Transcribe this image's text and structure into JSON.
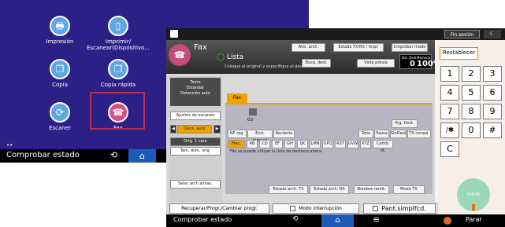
{
  "background": {
    "apps": [
      "Impresión",
      "Imprimir/ Escanear(Dispositivo...",
      "Copia",
      "Copia rápida",
      "Escaner",
      "Fax"
    ],
    "status": "Comprobar estado",
    "dots": "••"
  },
  "top": {
    "logout": "Fin.sesión"
  },
  "fax": {
    "title": "Fax",
    "list": "Lista",
    "instruction": "Coloque el original y especifique el destino.",
    "buttons": [
      "Alm. arch.",
      "Estado TX/RX / Impr.",
      "Cmprobar modo",
      "Busq. dest.",
      "Vista previa"
    ],
    "counter": {
      "dest_label": "Dst. Dest",
      "mem_label": "Memoria",
      "dest": "0",
      "mem": "100%"
    },
    "left": {
      "quality": "Texto",
      "res": "Estándar",
      "detect": "Detección auto",
      "scan": "Ajustes de escaneo",
      "dens": "Dens. auto",
      "orig": "Orig. 1 cara",
      "tam": "Tam. alim. orig.",
      "sel": "Selec arch almac."
    },
    "tab": "Fax",
    "g3": "G3",
    "row1": [
      "NF reg.",
      "Entr. manual",
      "Reciente"
    ],
    "row2": [
      "Tono",
      "Pausa",
      "SinDest",
      "TX inmed."
    ],
    "prg": "Prg. Dest.",
    "alpha": [
      "Frec.",
      "AB",
      "CD",
      "EF",
      "GH",
      "IJK",
      "LMN",
      "OPQ",
      "RST",
      "UVW",
      "XYZ",
      "Camb. tit."
    ],
    "note": "*No se puede utilizar la lista de destinos ahora.",
    "bottom_btns": [
      "Estado arch. TX",
      "Estado arch. RX",
      "Nombre remit.",
      "Modo TX"
    ]
  },
  "numpad": {
    "reset": "Restablecer",
    "keys": [
      "1",
      "2",
      "3",
      "4",
      "5",
      "6",
      "7",
      "8",
      "9",
      "/✱",
      "0",
      "#",
      "C"
    ],
    "start": "Inicio"
  },
  "bottom1": {
    "recover": "Recuperar/Progr./Cambiar progr.",
    "interrupt": "Modo interrupción",
    "pant": "Pant.simplfcd."
  },
  "bottom2": {
    "status": "Comprobar estado",
    "stop": "Parar"
  }
}
